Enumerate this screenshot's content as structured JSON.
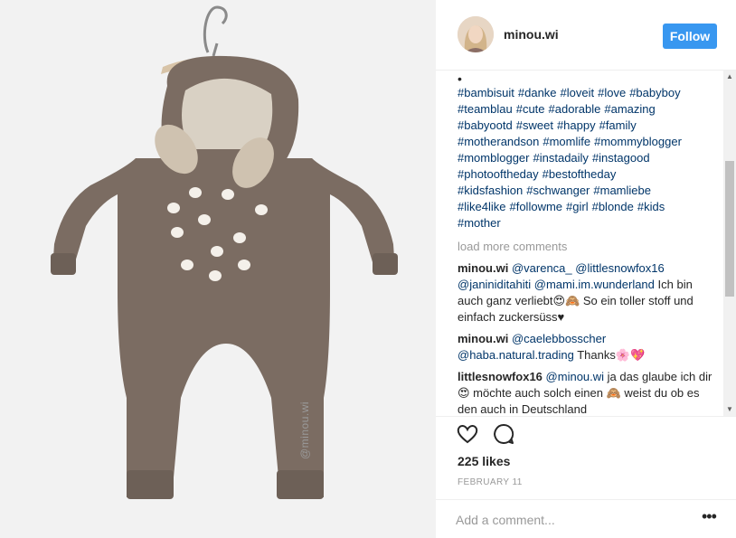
{
  "photo": {
    "watermark": "@minou.wi",
    "alt_subject": "brown fawn romper on hanger"
  },
  "header": {
    "username": "minou.wi",
    "follow_label": "Follow",
    "accent_color": "#3897f0"
  },
  "comments": {
    "bullet": "•",
    "hashtags": [
      "#bambisuit",
      "#danke",
      "#loveit",
      "#love",
      "#babyboy",
      "#teamblau",
      "#cute",
      "#adorable",
      "#amazing",
      "#babyootd",
      "#sweet",
      "#happy",
      "#family",
      "#motherandson",
      "#momlife",
      "#mommyblogger",
      "#momblogger",
      "#instadaily",
      "#instagood",
      "#photooftheday",
      "#bestoftheday",
      "#kidsfashion",
      "#schwanger",
      "#mamliebe",
      "#like4like",
      "#followme",
      "#girl",
      "#blonde",
      "#kids",
      "#mother"
    ],
    "load_more": "load more comments",
    "items": [
      {
        "author": "minou.wi",
        "mention1": "@varenca_",
        "mention2": "@littlesnowfox16",
        "mention3": "@janiniditahiti",
        "mention4": "@mami.im.wunderland",
        "text": " Ich bin auch ganz verliebt😍🙈 So ein toller stoff und einfach zuckersüss♥"
      },
      {
        "author": "minou.wi",
        "mention1": "@caelebbosscher",
        "mention2": "@haba.natural.trading",
        "text": " Thanks🌸💖"
      },
      {
        "author": "littlesnowfox16",
        "mention1": "@minou.wi",
        "text": " ja das glaube ich dir 😍 möchte auch solch einen 🙈 weist du ob es den auch in Deutschland"
      }
    ]
  },
  "actions": {
    "like_icon": "heart-icon",
    "comment_icon": "comment-icon",
    "likes": "225 likes",
    "date": "FEBRUARY 11"
  },
  "add_comment": {
    "placeholder": "Add a comment...",
    "more_icon": "more-options-icon",
    "more_glyph": "•••"
  }
}
